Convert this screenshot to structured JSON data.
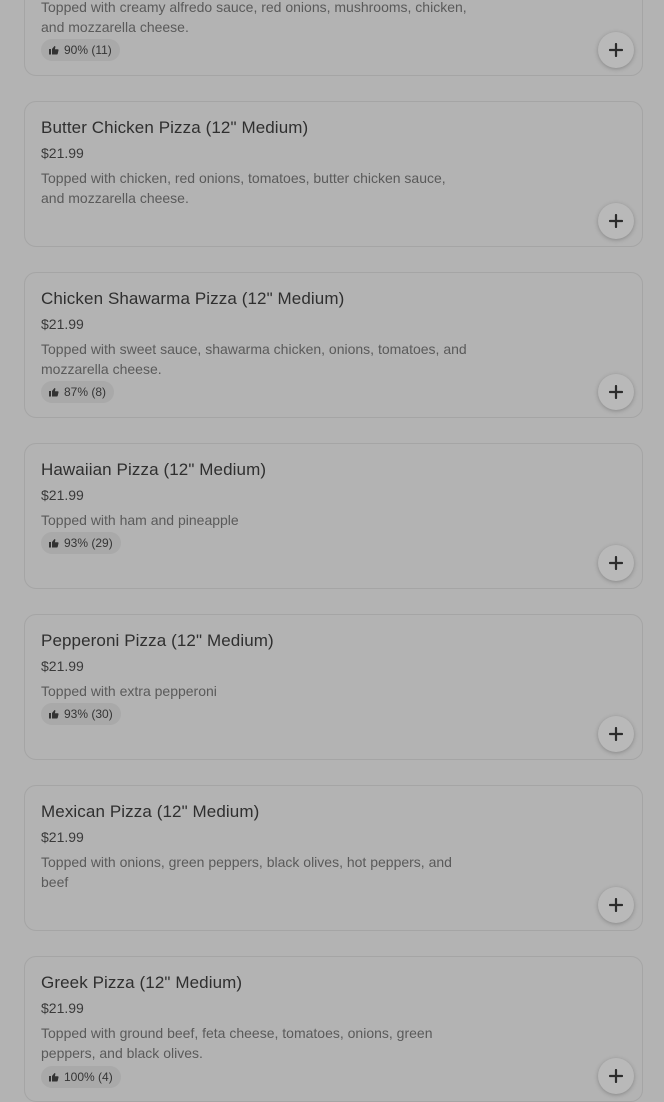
{
  "menu_items": [
    {
      "name": "",
      "price": "",
      "description_lines": [
        "Topped with creamy alfredo sauce, red onions, mushrooms, chicken,",
        "and mozzarella cheese."
      ],
      "rating": "90% (11)"
    },
    {
      "name": "Butter Chicken Pizza (12\" Medium)",
      "price": "$21.99",
      "description_lines": [
        "Topped with chicken, red onions, tomatoes, butter chicken sauce,",
        "and mozzarella cheese."
      ],
      "rating": ""
    },
    {
      "name": "Chicken Shawarma Pizza (12\" Medium)",
      "price": "$21.99",
      "description_lines": [
        "Topped with sweet sauce, shawarma chicken, onions, tomatoes, and",
        "mozzarella cheese."
      ],
      "rating": "87% (8)"
    },
    {
      "name": "Hawaiian Pizza (12\" Medium)",
      "price": "$21.99",
      "description_lines": [
        "Topped with ham and pineapple"
      ],
      "rating": "93% (29)"
    },
    {
      "name": "Pepperoni Pizza (12\" Medium)",
      "price": "$21.99",
      "description_lines": [
        "Topped with extra pepperoni"
      ],
      "rating": "93% (30)"
    },
    {
      "name": "Mexican Pizza (12\" Medium)",
      "price": "$21.99",
      "description_lines": [
        "Topped with onions, green peppers, black olives, hot peppers, and",
        "beef"
      ],
      "rating": ""
    },
    {
      "name": "Greek Pizza (12\" Medium)",
      "price": "$21.99",
      "description_lines": [
        "Topped with ground beef, feta cheese, tomatoes, onions, green",
        "peppers, and black olives."
      ],
      "rating": "100% (4)"
    }
  ],
  "icons": {
    "rating": "thumbs-up-icon",
    "add": "plus-icon"
  },
  "colors": {
    "background": "#b3b3b3",
    "card_border": "#a5a5a5",
    "badge_bg": "#a9a9a9"
  }
}
